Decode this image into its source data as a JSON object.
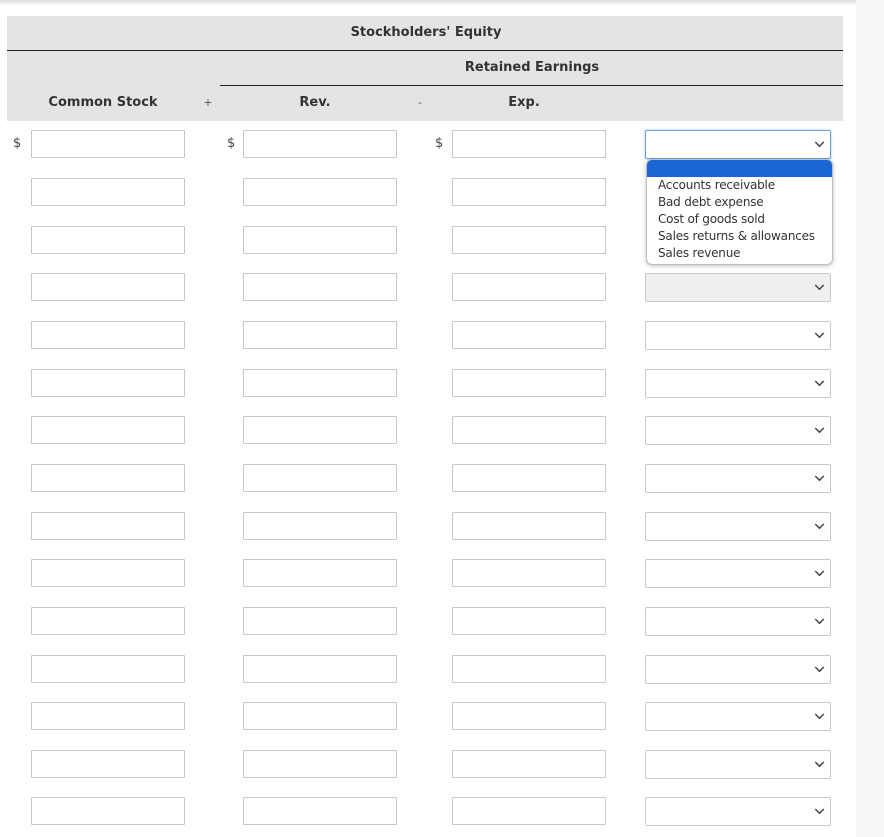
{
  "header": {
    "group_title": "Stockholders' Equity",
    "subgroup_title": "Retained Earnings",
    "columns": {
      "common_stock": "Common Stock",
      "plus_operator": "+",
      "revenue": "Rev.",
      "minus_operator": "-",
      "expense": "Exp."
    }
  },
  "currency_symbol": "$",
  "rows": [
    {
      "common_stock": "",
      "revenue": "",
      "expense": "",
      "account": "",
      "select_state": "focused"
    },
    {
      "common_stock": "",
      "revenue": "",
      "expense": "",
      "account": "",
      "select_state": "hidden"
    },
    {
      "common_stock": "",
      "revenue": "",
      "expense": "",
      "account": "",
      "select_state": "hidden"
    },
    {
      "common_stock": "",
      "revenue": "",
      "expense": "",
      "account": "",
      "select_state": "disabled"
    },
    {
      "common_stock": "",
      "revenue": "",
      "expense": "",
      "account": "",
      "select_state": "normal"
    },
    {
      "common_stock": "",
      "revenue": "",
      "expense": "",
      "account": "",
      "select_state": "normal"
    },
    {
      "common_stock": "",
      "revenue": "",
      "expense": "",
      "account": "",
      "select_state": "normal"
    },
    {
      "common_stock": "",
      "revenue": "",
      "expense": "",
      "account": "",
      "select_state": "normal"
    },
    {
      "common_stock": "",
      "revenue": "",
      "expense": "",
      "account": "",
      "select_state": "normal"
    },
    {
      "common_stock": "",
      "revenue": "",
      "expense": "",
      "account": "",
      "select_state": "normal"
    },
    {
      "common_stock": "",
      "revenue": "",
      "expense": "",
      "account": "",
      "select_state": "normal"
    },
    {
      "common_stock": "",
      "revenue": "",
      "expense": "",
      "account": "",
      "select_state": "normal"
    },
    {
      "common_stock": "",
      "revenue": "",
      "expense": "",
      "account": "",
      "select_state": "normal"
    },
    {
      "common_stock": "",
      "revenue": "",
      "expense": "",
      "account": "",
      "select_state": "normal"
    },
    {
      "common_stock": "",
      "revenue": "",
      "expense": "",
      "account": "",
      "select_state": "normal"
    }
  ],
  "dropdown": {
    "open": true,
    "highlighted_option": "",
    "options": [
      "",
      "Accounts receivable",
      "Bad debt expense",
      "Cost of goods sold",
      "Sales returns & allowances",
      "Sales revenue"
    ]
  },
  "colors": {
    "header_bg": "#e4e4e4",
    "highlight": "#1a66d2",
    "focus_border": "#6aa0e0"
  }
}
